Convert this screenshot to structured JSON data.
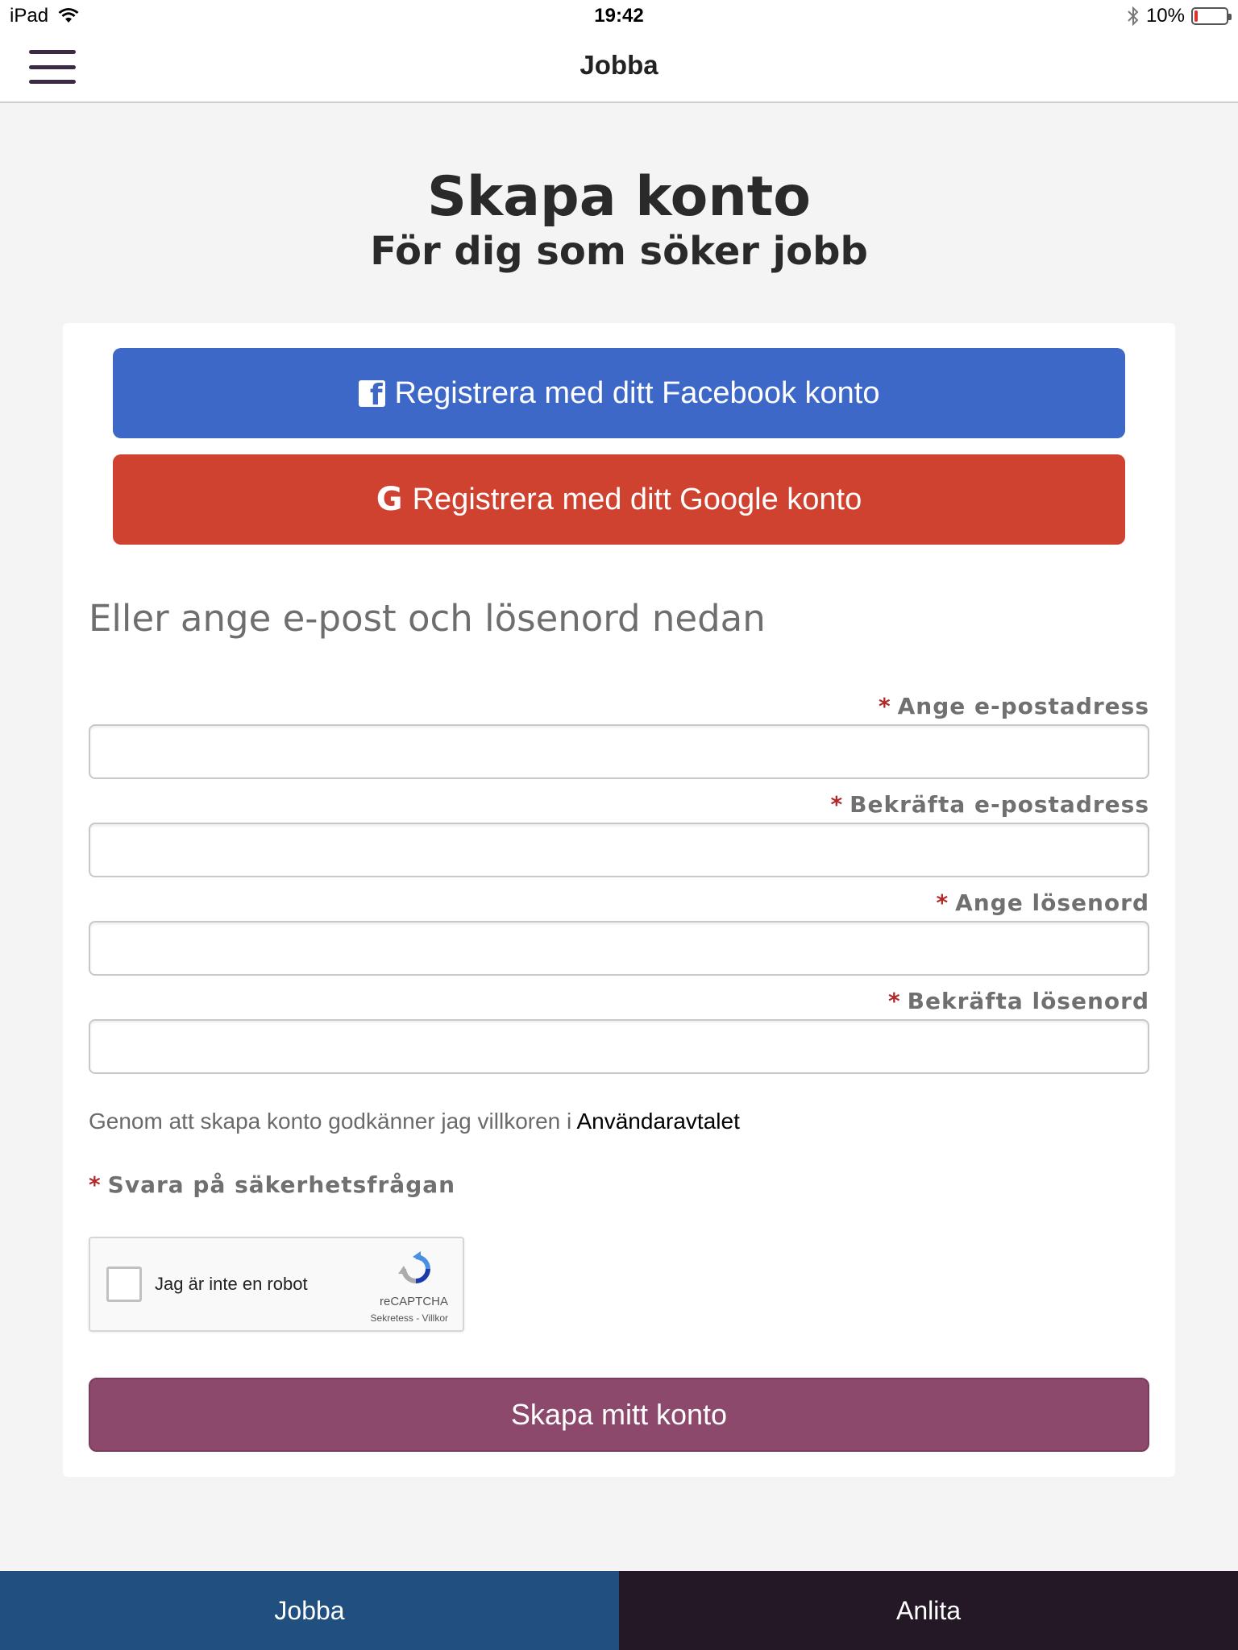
{
  "status_bar": {
    "device": "iPad",
    "time": "19:42",
    "battery_percent": "10%",
    "battery_level": 0.1
  },
  "nav": {
    "title": "Jobba"
  },
  "page": {
    "title": "Skapa konto",
    "subtitle": "För dig som söker jobb"
  },
  "social": {
    "facebook_label": "Registrera med ditt Facebook konto",
    "google_label": "Registrera med ditt Google konto",
    "facebook_color": "#3d68c8",
    "google_color": "#d04230"
  },
  "form": {
    "or_heading": "Eller ange e-post och lösenord nedan",
    "required_marker": "*",
    "fields": [
      {
        "label": "Ange e-postadress",
        "value": ""
      },
      {
        "label": "Bekräfta e-postadress",
        "value": ""
      },
      {
        "label": "Ange lösenord",
        "value": ""
      },
      {
        "label": "Bekräfta lösenord",
        "value": ""
      }
    ],
    "terms_text": "Genom att skapa konto godkänner jag villkoren i ",
    "terms_link": "Användaravtalet",
    "security_label": "Svara på säkerhetsfrågan",
    "submit_label": "Skapa mitt konto",
    "submit_color": "#8d496b"
  },
  "recaptcha": {
    "label": "Jag är inte en robot",
    "brand": "reCAPTCHA",
    "links": "Sekretess - Villkor",
    "checked": false
  },
  "tabs": [
    {
      "label": "Jobba",
      "active": true,
      "color": "#214f80"
    },
    {
      "label": "Anlita",
      "active": false,
      "color": "#241827"
    }
  ]
}
